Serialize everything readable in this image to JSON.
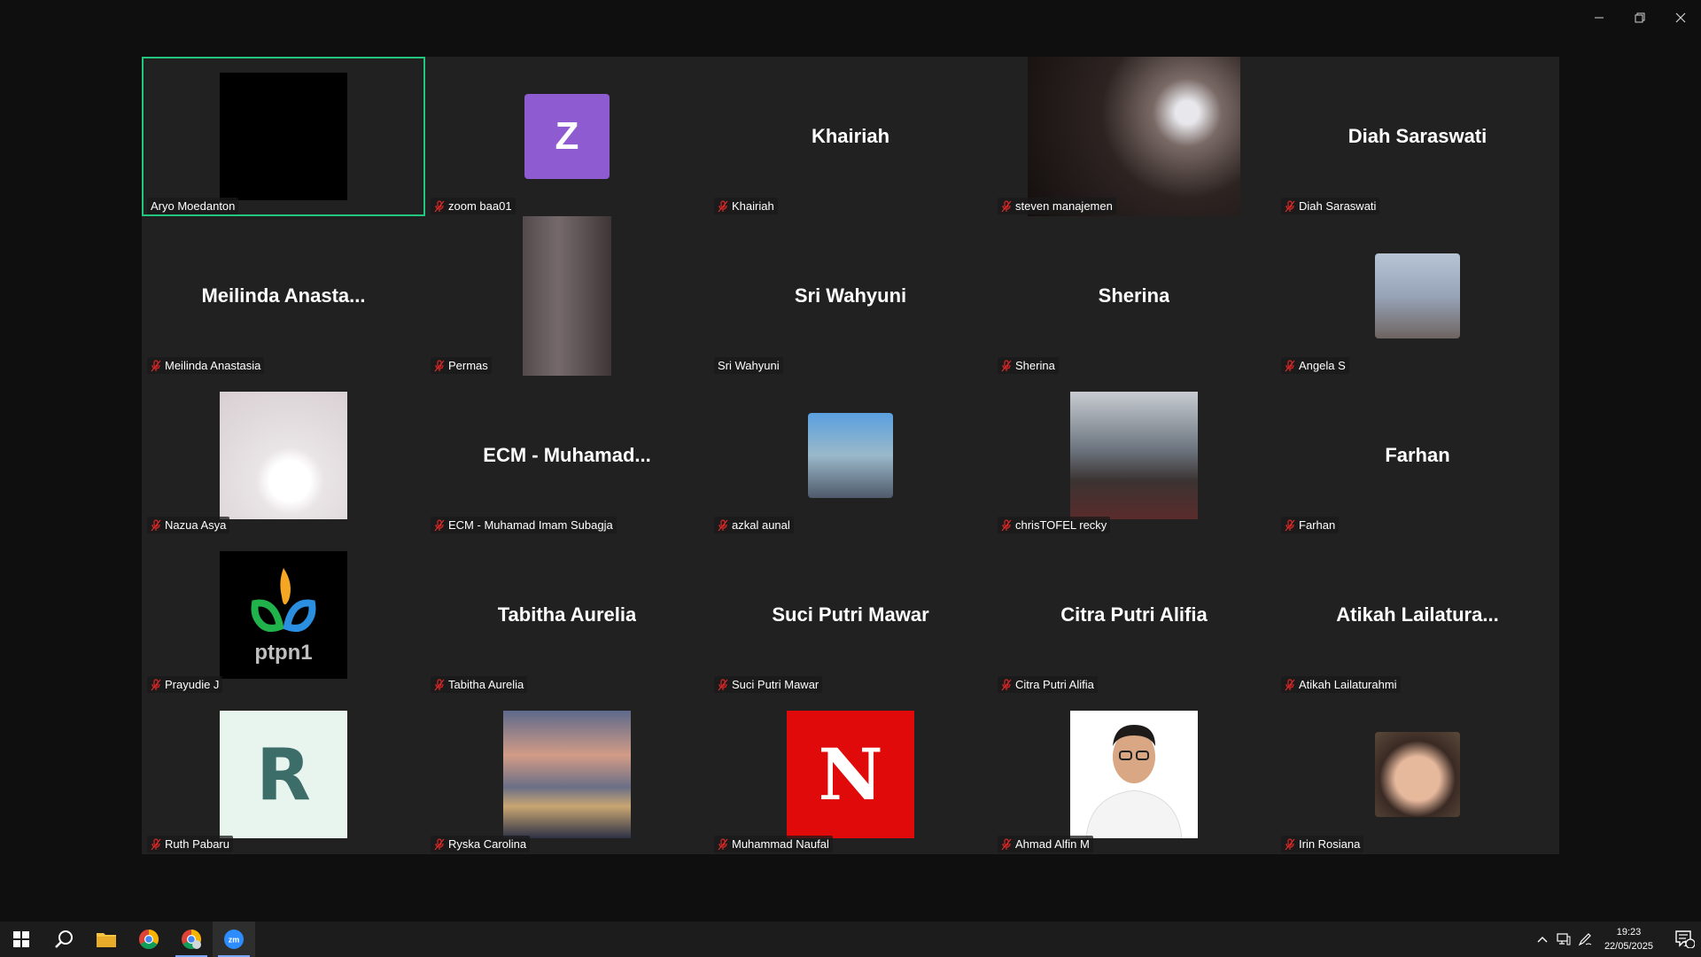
{
  "window": {
    "controls": [
      "minimize",
      "maximize",
      "close"
    ]
  },
  "participants": [
    {
      "name": "Aryo Moedanton",
      "muted": false,
      "active": true,
      "avatar": "black"
    },
    {
      "name": "zoom baa01",
      "muted": true,
      "avatar": "letter",
      "letter": "Z",
      "color": "#8e5bd0"
    },
    {
      "name": "Khairiah",
      "muted": true,
      "display": "Khairiah"
    },
    {
      "name": "steven manajemen",
      "muted": true,
      "avatar": "video"
    },
    {
      "name": "Diah Saraswati",
      "muted": true,
      "display": "Diah Saraswati"
    },
    {
      "name": "Meilinda Anastasia",
      "muted": true,
      "display": "Meilinda  Anasta..."
    },
    {
      "name": "Permas",
      "muted": true,
      "avatar": "video"
    },
    {
      "name": "Sri Wahyuni",
      "muted": false,
      "display": "Sri Wahyuni"
    },
    {
      "name": "Sherina",
      "muted": true,
      "display": "Sherina"
    },
    {
      "name": "Angela S",
      "muted": true,
      "avatar": "photo"
    },
    {
      "name": "Nazua Asya",
      "muted": true,
      "avatar": "photo"
    },
    {
      "name": "ECM - Muhamad Imam Subagja",
      "muted": true,
      "display": "ECM  -  Muhamad..."
    },
    {
      "name": "azkal aunal",
      "muted": true,
      "avatar": "photo"
    },
    {
      "name": "chrisTOFEL recky",
      "muted": true,
      "avatar": "photo"
    },
    {
      "name": "Farhan",
      "muted": true,
      "display": "Farhan"
    },
    {
      "name": "Prayudie J",
      "muted": true,
      "avatar": "logo",
      "logo_text": "ptpn1"
    },
    {
      "name": "Tabitha Aurelia",
      "muted": true,
      "display": "Tabitha Aurelia"
    },
    {
      "name": "Suci Putri Mawar",
      "muted": true,
      "display": "Suci Putri Mawar"
    },
    {
      "name": "Citra Putri Alifia",
      "muted": true,
      "display": "Citra Putri Alifia"
    },
    {
      "name": "Atikah Lailaturahmi",
      "muted": true,
      "display": "Atikah  Lailatura..."
    },
    {
      "name": "Ruth Pabaru",
      "muted": true,
      "avatar": "letter",
      "letter": "R"
    },
    {
      "name": "Ryska Carolina",
      "muted": true,
      "avatar": "photo"
    },
    {
      "name": "Muhammad Naufal",
      "muted": true,
      "avatar": "letter",
      "letter": "N"
    },
    {
      "name": "Ahmad Alfin M",
      "muted": true,
      "avatar": "photo"
    },
    {
      "name": "Irin Rosiana",
      "muted": true,
      "avatar": "photo"
    }
  ],
  "taskbar": {
    "apps": [
      "start-icon",
      "search-icon",
      "file-explorer-icon",
      "chrome-icon",
      "chrome-profile-icon",
      "zoom-icon"
    ],
    "clock_time": "19:23",
    "clock_date": "22/05/2025",
    "notification_count": "1"
  },
  "colors": {
    "active_speaker": "#23c67f",
    "muted_icon": "#e02828"
  }
}
